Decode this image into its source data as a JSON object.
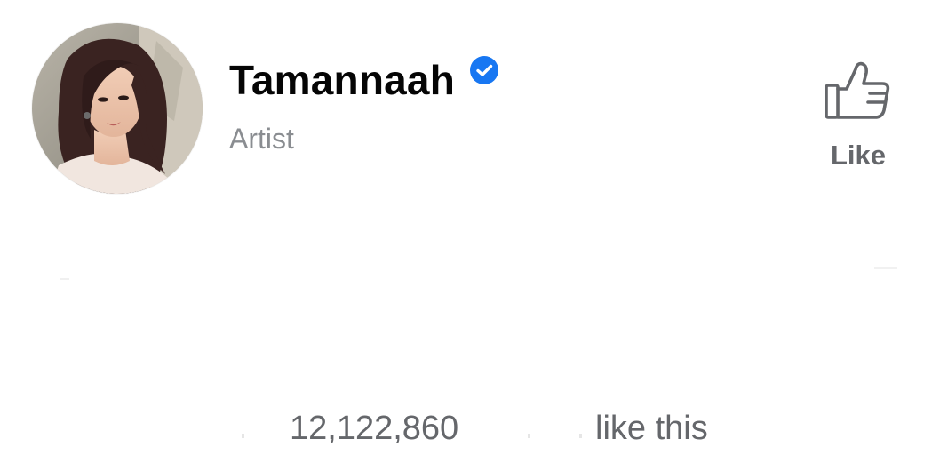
{
  "profile": {
    "name": "Tamannaah",
    "category": "Artist",
    "verified": true,
    "avatar_icon": "profile-photo"
  },
  "actions": {
    "like_label": "Like",
    "like_icon": "thumbs-up-icon"
  },
  "likes": {
    "count": "12,122,860",
    "suffix": "like this"
  },
  "colors": {
    "name": "#050505",
    "secondary_text": "#8a8d91",
    "like_text": "#65676b",
    "verified_badge": "#1877f2",
    "icon_stroke": "#65676b"
  }
}
